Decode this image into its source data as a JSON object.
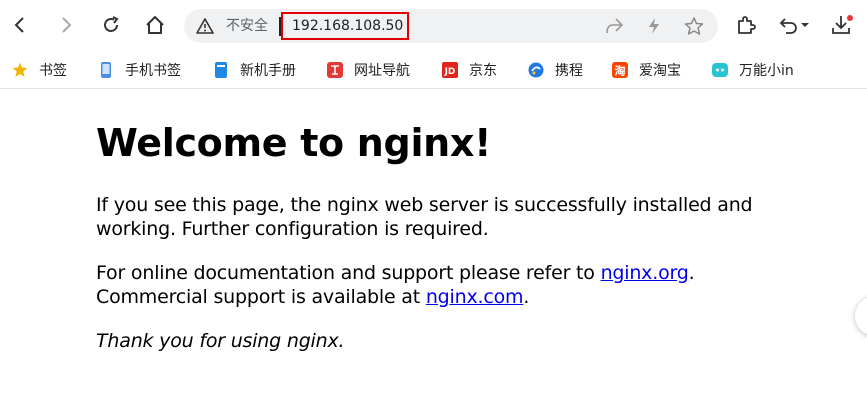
{
  "browser": {
    "insecure_label": "不安全",
    "url": "192.168.108.50"
  },
  "bookmarks": [
    {
      "label": "书签",
      "icon": "star-icon",
      "color": "#f5b400"
    },
    {
      "label": "手机书签",
      "icon": "phone-icon",
      "color": "#4a90e2"
    },
    {
      "label": "新机手册",
      "icon": "book-icon",
      "color": "#1e88e5"
    },
    {
      "label": "网址导航",
      "icon": "nav-icon",
      "color": "#e53935"
    },
    {
      "label": "京东",
      "icon": "jd-icon",
      "color": "#e1251b"
    },
    {
      "label": "携程",
      "icon": "ctrip-icon",
      "color": "#2577e3"
    },
    {
      "label": "爱淘宝",
      "icon": "taobao-icon",
      "color": "#ff4400"
    },
    {
      "label": "万能小in",
      "icon": "in-icon",
      "color": "#27c4d0"
    }
  ],
  "page": {
    "heading": "Welcome to nginx!",
    "p1_line1": "If you see this page, the nginx web server is successfully installed and",
    "p1_line2": "working. Further configuration is required.",
    "p2_line1_pre": "For online documentation and support please refer to ",
    "p2_link1": "nginx.org",
    "p2_line1_post": ".",
    "p2_line2_pre": "Commercial support is available at ",
    "p2_link2": "nginx.com",
    "p2_line2_post": ".",
    "p3": "Thank you for using nginx."
  }
}
